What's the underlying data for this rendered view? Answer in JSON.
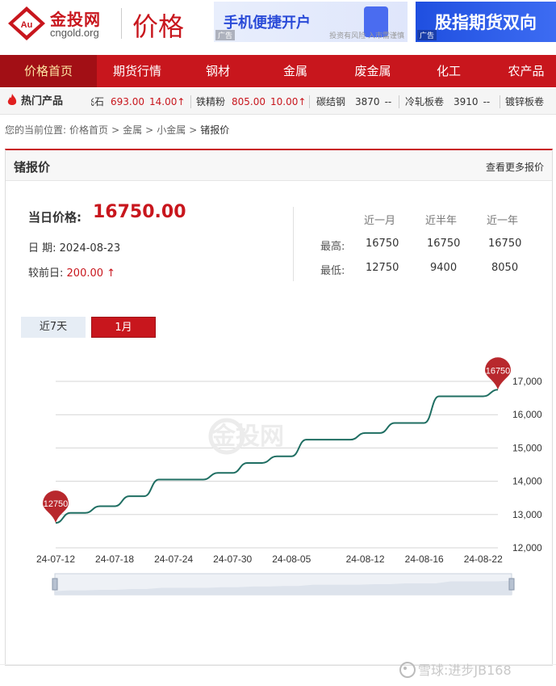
{
  "header": {
    "logo_cn": "金投网",
    "logo_en": "cngold.org",
    "logo_badge": "Au",
    "title": "价格",
    "ad1": {
      "text": "手机便捷开户",
      "tag": "广告",
      "note": "投资有风险 入市需谨慎"
    },
    "ad2": {
      "text": "股指期货双向",
      "tag": "广告"
    }
  },
  "nav": {
    "items": [
      {
        "label": "价格首页",
        "active": true
      },
      {
        "label": "期货行情"
      },
      {
        "label": "钢材"
      },
      {
        "label": "金属"
      },
      {
        "label": "废金属"
      },
      {
        "label": "化工"
      },
      {
        "label": "农产品"
      }
    ]
  },
  "hot": {
    "label": "热门产品",
    "tickers": [
      {
        "name": "飞石",
        "value": "693.00",
        "change": "14.00↑"
      },
      {
        "name": "铁精粉",
        "value": "805.00",
        "change": "10.00↑"
      },
      {
        "name": "碳结钢",
        "value": "3870",
        "change": "--"
      },
      {
        "name": "冷轧板卷",
        "value": "3910",
        "change": "--"
      },
      {
        "name": "镀锌板卷",
        "value": "",
        "change": ""
      }
    ]
  },
  "breadcrumb": [
    "您的当前位置:",
    "价格首页",
    ">",
    "金属",
    ">",
    "小金属",
    ">",
    "锗报价"
  ],
  "panel": {
    "title": "锗报价",
    "more": "查看更多报价",
    "price_label": "当日价格:",
    "price_value": "16750.00",
    "date_label": "日 期:",
    "date_value": "2024-08-23",
    "change_label": "较前日:",
    "change_value": "200.00 ↑",
    "stats": {
      "headers": [
        "近一月",
        "近半年",
        "近一年"
      ],
      "rows": [
        {
          "label": "最高:",
          "values": [
            "16750",
            "16750",
            "16750"
          ]
        },
        {
          "label": "最低:",
          "values": [
            "12750",
            "9400",
            "8050"
          ]
        }
      ]
    },
    "tabs": [
      {
        "label": "近7天",
        "active": false
      },
      {
        "label": "1月",
        "active": true
      }
    ]
  },
  "chart_data": {
    "type": "line",
    "x": [
      "24-07-12",
      "24-07-15",
      "24-07-16",
      "24-07-17",
      "24-07-18",
      "24-07-19",
      "24-07-22",
      "24-07-23",
      "24-07-24",
      "24-07-25",
      "24-07-26",
      "24-07-29",
      "24-07-30",
      "24-07-31",
      "24-08-01",
      "24-08-02",
      "24-08-05",
      "24-08-06",
      "24-08-07",
      "24-08-08",
      "24-08-09",
      "24-08-12",
      "24-08-13",
      "24-08-14",
      "24-08-15",
      "24-08-16",
      "24-08-19",
      "24-08-20",
      "24-08-21",
      "24-08-22",
      "24-08-23"
    ],
    "series": [
      {
        "values": [
          12750,
          13050,
          13050,
          13250,
          13250,
          13550,
          13550,
          14050,
          14050,
          14050,
          14050,
          14250,
          14250,
          14550,
          14550,
          14750,
          14750,
          15250,
          15250,
          15250,
          15250,
          15450,
          15450,
          15750,
          15750,
          15750,
          16550,
          16550,
          16550,
          16550,
          16750
        ]
      }
    ],
    "xticks": [
      "24-07-12",
      "24-07-18",
      "24-07-24",
      "24-07-30",
      "24-08-05",
      "24-08-12",
      "24-08-16",
      "24-08-22"
    ],
    "yticks": [
      12000,
      13000,
      14000,
      15000,
      16000,
      17000
    ],
    "ylim": [
      12000,
      17000
    ],
    "markers": [
      {
        "label": "12750",
        "index": 0
      },
      {
        "label": "16750",
        "index": 30
      }
    ],
    "watermark": "金投网",
    "grid": true,
    "line_color": "#1f6e62",
    "marker_color": "#b8282d"
  },
  "footer": {
    "watermark": "雪球:进步JB168"
  }
}
